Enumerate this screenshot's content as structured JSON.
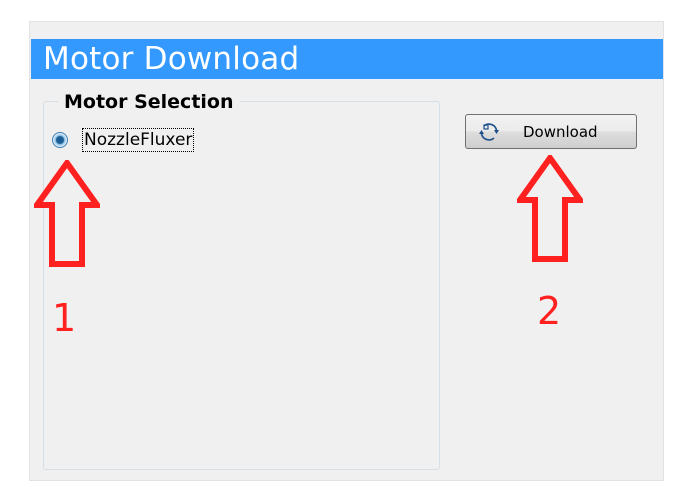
{
  "header": {
    "title": "Motor Download"
  },
  "motor_selection": {
    "legend": "Motor Selection",
    "options": [
      {
        "label": "NozzleFluxer",
        "selected": true
      }
    ]
  },
  "download_button": {
    "label": "Download",
    "icon": "refresh-arrows-icon"
  },
  "annotations": {
    "step1": "1",
    "step2": "2",
    "color": "#ff2020"
  },
  "colors": {
    "header_bg": "#3399ff",
    "panel_bg": "#f0f0f0"
  }
}
